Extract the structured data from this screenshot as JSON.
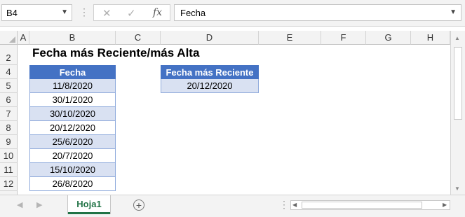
{
  "formula_bar": {
    "name_box": "B4",
    "cancel_symbol": "✕",
    "enter_symbol": "✓",
    "function_symbol": "fx",
    "formula_value": "Fecha"
  },
  "columns": [
    "A",
    "B",
    "C",
    "D",
    "E",
    "F",
    "G",
    "H"
  ],
  "rows": [
    "2",
    "4",
    "5",
    "6",
    "7",
    "8",
    "9",
    "10",
    "11",
    "12"
  ],
  "sheet": {
    "title": "Fecha más Reciente/más Alta",
    "table1": {
      "header": "Fecha",
      "values": [
        "11/8/2020",
        "30/1/2020",
        "30/10/2020",
        "20/12/2020",
        "25/6/2020",
        "20/7/2020",
        "15/10/2020",
        "26/8/2020"
      ]
    },
    "table2": {
      "header": "Fecha más Reciente",
      "value": "20/12/2020"
    }
  },
  "tabs": {
    "active": "Hoja1",
    "add_symbol": "+"
  },
  "colors": {
    "header_fill": "#4472c4",
    "band_fill": "#d9e1f2",
    "accent_green": "#217346"
  }
}
